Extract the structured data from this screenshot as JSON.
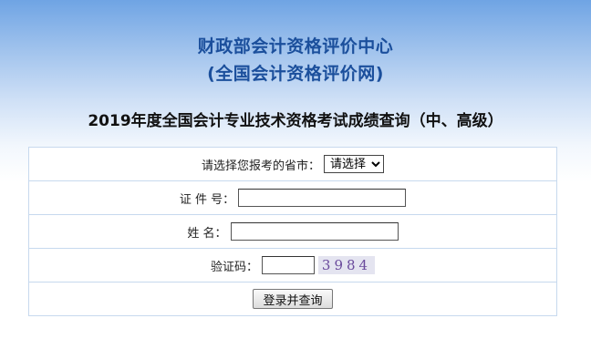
{
  "header": {
    "title": "财政部会计资格评价中心",
    "subtitle": "(全国会计资格评价网)"
  },
  "exam_title": "2019年度全国会计专业技术资格考试成绩查询（中、高级）",
  "form": {
    "province": {
      "label": "请选择您报考的省市：",
      "selected": "请选择"
    },
    "cert": {
      "label": "证 件 号：",
      "value": ""
    },
    "name": {
      "label": "姓  名：",
      "value": ""
    },
    "captcha": {
      "label": "验证码：",
      "value": "",
      "image_text": "3984"
    },
    "submit_label": "登录并查询"
  }
}
